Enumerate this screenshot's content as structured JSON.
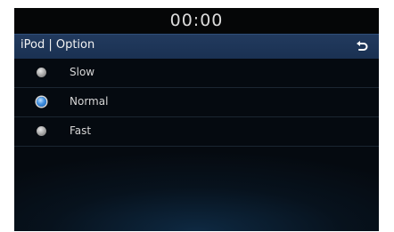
{
  "status_bar": {
    "time": "00:00"
  },
  "header": {
    "title": "iPod | Option",
    "back_icon": "return-arrow-icon"
  },
  "options": [
    {
      "label": "Slow",
      "selected": false
    },
    {
      "label": "Normal",
      "selected": true
    },
    {
      "label": "Fast",
      "selected": false
    }
  ],
  "colors": {
    "header_bg": "#1a3152",
    "selected_radio": "#3f8fe0",
    "unselected_radio": "#a0a0a0",
    "screen_bg": "#050a10"
  }
}
